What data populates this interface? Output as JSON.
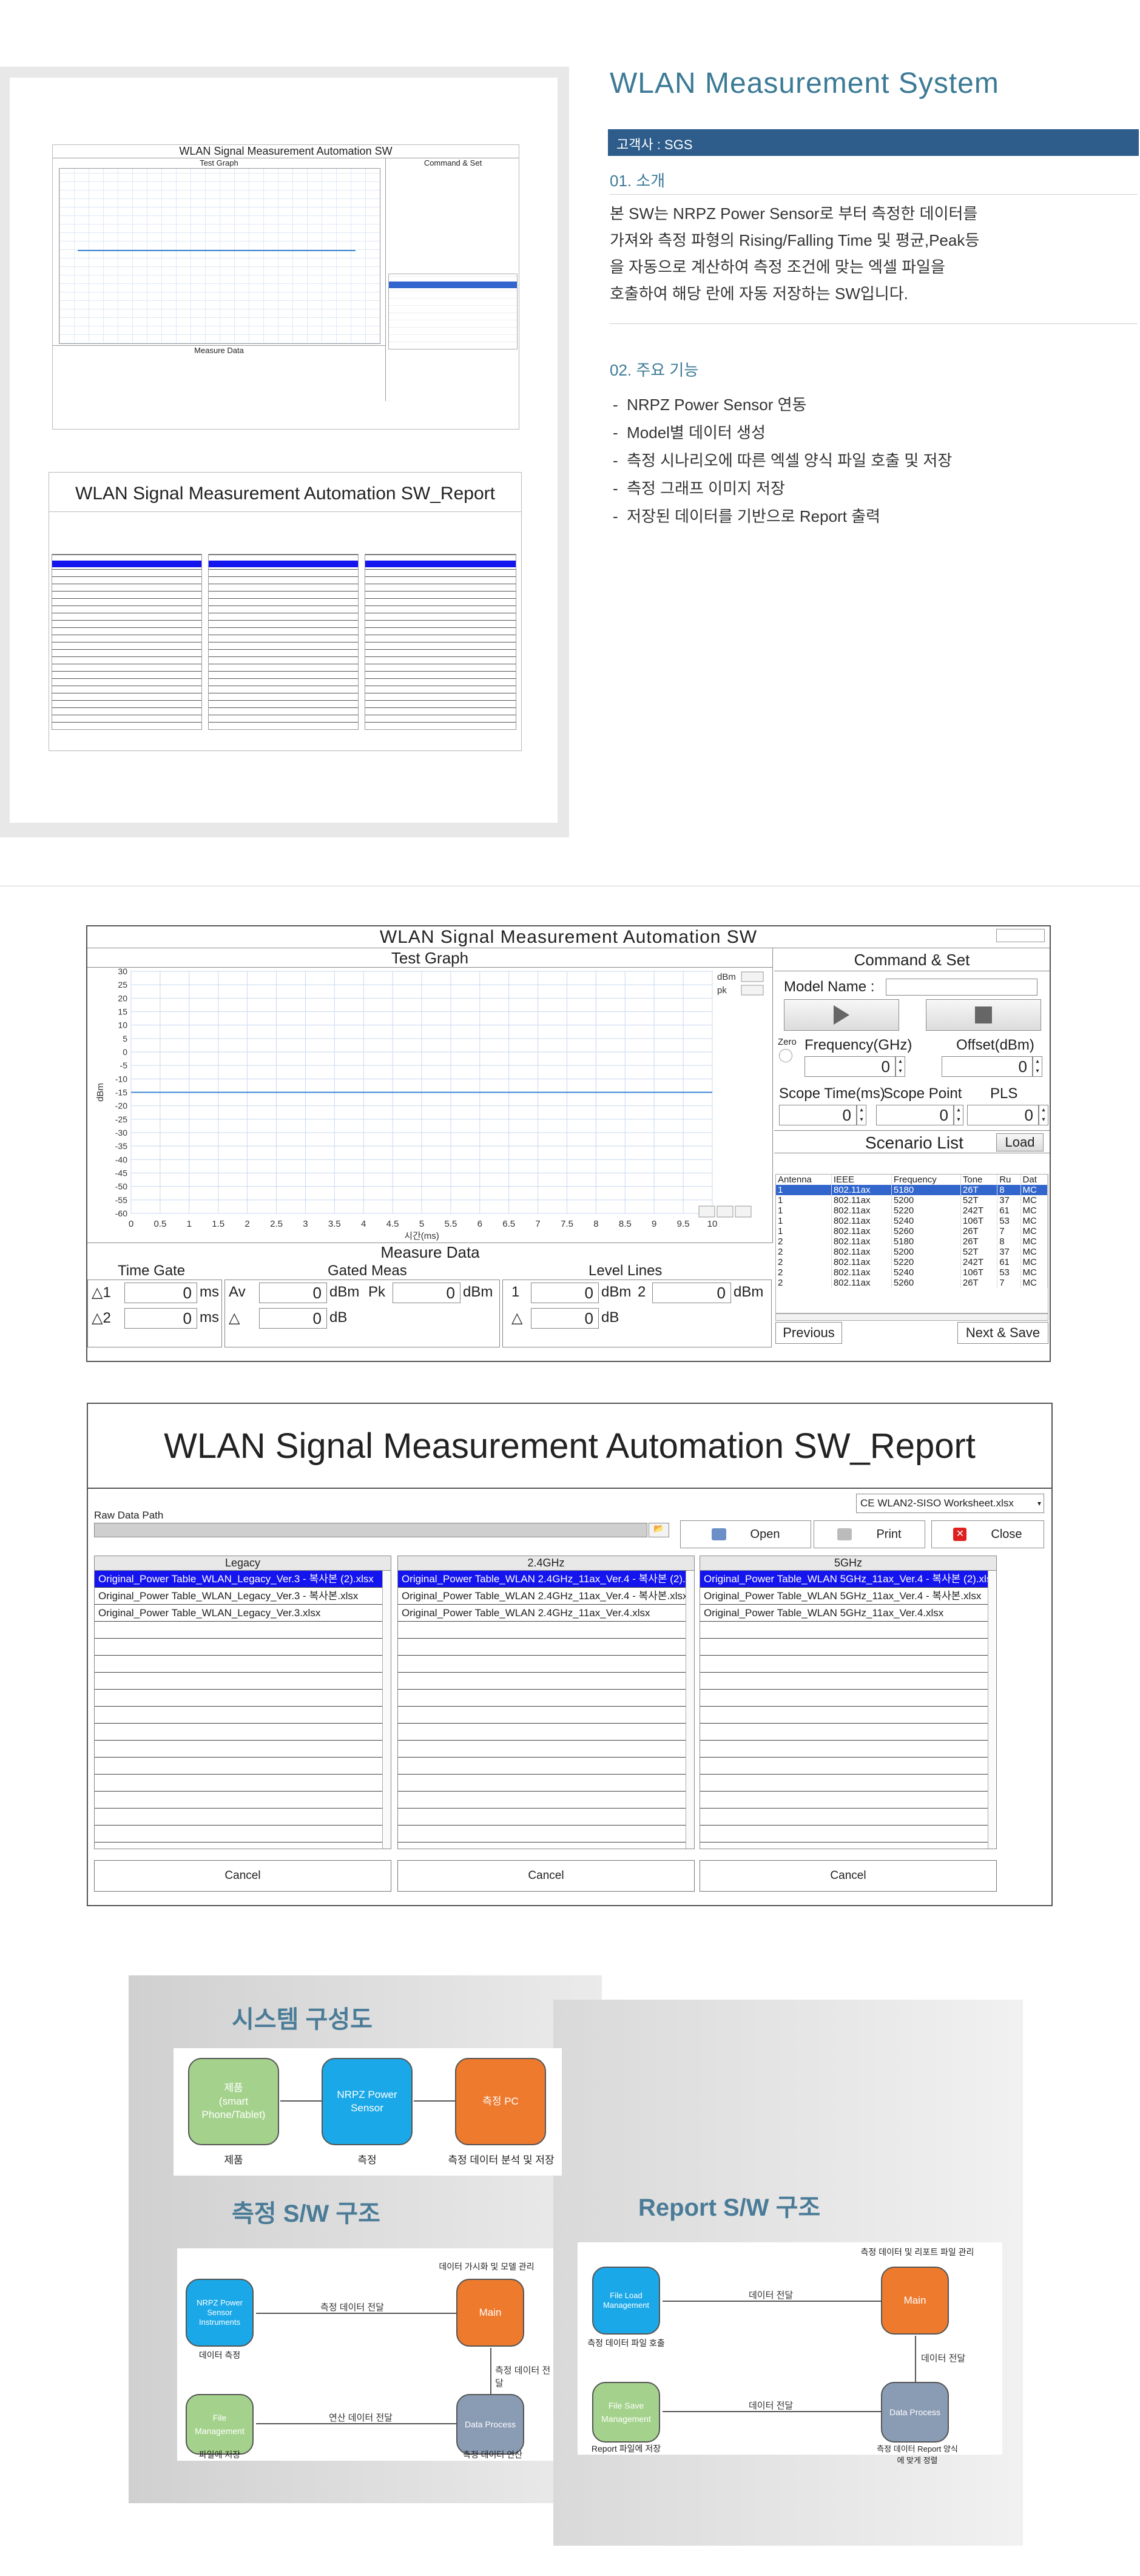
{
  "overview": {
    "title": "WLAN Measurement System",
    "client": "고객사 : SGS",
    "intro_heading": "01. 소개",
    "intro_lines": [
      "본 SW는 NRPZ Power Sensor로 부터 측정한 데이터를",
      "가져와 측정 파형의 Rising/Falling Time 및 평균,Peak등",
      "을 자동으로 계산하여 측정 조건에 맞는 엑셀 파일을",
      "호출하여 해당 란에 자동 저장하는 SW입니다."
    ],
    "features_heading": "02. 주요 기능",
    "features": [
      "NRPZ Power Sensor 연동",
      "Model별 데이터 생성",
      "측정 시나리오에 따른 엑셀 양식 파일 호출 및 저장",
      "측정 그래프 이미지 저장",
      "저장된 데이터를 기반으로 Report 출력"
    ]
  },
  "meas_app": {
    "title": "WLAN  Signal Measurement Automation SW",
    "graph_title": "Test Graph",
    "command_title": "Command & Set",
    "legend": [
      "dBm",
      "pk"
    ],
    "model_name_label": "Model Name :",
    "model_name_value": "",
    "zero_label": "Zero",
    "frequency_label": "Frequency(GHz)",
    "frequency_value": "0",
    "offset_label": "Offset(dBm)",
    "offset_value": "0",
    "scope_time_label": "Scope Time(ms)",
    "scope_time_value": "0",
    "scope_point_label": "Scope Point",
    "scope_point_value": "0",
    "pls_label": "PLS",
    "pls_value": "0",
    "scenario_title": "Scenario List",
    "load_label": "Load",
    "scenario_columns": [
      "Antenna",
      "IEEE",
      "Frequency",
      "Tone",
      "Ru",
      "Dat"
    ],
    "scenario_rows": [
      [
        "1",
        "802.11ax",
        "5180",
        "26T",
        "8",
        "MC"
      ],
      [
        "1",
        "802.11ax",
        "5200",
        "52T",
        "37",
        "MC"
      ],
      [
        "1",
        "802.11ax",
        "5220",
        "242T",
        "61",
        "MC"
      ],
      [
        "1",
        "802.11ax",
        "5240",
        "106T",
        "53",
        "MC"
      ],
      [
        "1",
        "802.11ax",
        "5260",
        "26T",
        "7",
        "MC"
      ],
      [
        "2",
        "802.11ax",
        "5180",
        "26T",
        "8",
        "MC"
      ],
      [
        "2",
        "802.11ax",
        "5200",
        "52T",
        "37",
        "MC"
      ],
      [
        "2",
        "802.11ax",
        "5220",
        "242T",
        "61",
        "MC"
      ],
      [
        "2",
        "802.11ax",
        "5240",
        "106T",
        "53",
        "MC"
      ],
      [
        "2",
        "802.11ax",
        "5260",
        "26T",
        "7",
        "MC"
      ]
    ],
    "previous_label": "Previous",
    "next_label": "Next & Save",
    "measure_title": "Measure Data",
    "time_gate_label": "Time Gate",
    "gated_meas_label": "Gated Meas",
    "level_lines_label": "Level Lines",
    "delta1_label": "△1",
    "delta2_label": "△2",
    "av_label": "Av",
    "pk_label": "Pk",
    "delta_label": "△",
    "level1_label": "1",
    "level2_label": "2",
    "unit_ms": "ms",
    "unit_dbm": "dBm",
    "unit_db": "dB",
    "zero_value": "0",
    "xaxis_label": "시간(ms)",
    "yaxis_label": "dBm"
  },
  "chart_data": {
    "type": "line",
    "title": "Test Graph",
    "xlabel": "시간(ms)",
    "ylabel": "dBm",
    "xlim": [
      0,
      10
    ],
    "ylim": [
      -60,
      30
    ],
    "x_ticks": [
      "0",
      "0.5",
      "1",
      "1.5",
      "2",
      "2.5",
      "3",
      "3.5",
      "4",
      "4.5",
      "5",
      "5.5",
      "6",
      "6.5",
      "7",
      "7.5",
      "8",
      "8.5",
      "9",
      "9.5",
      "10"
    ],
    "y_ticks": [
      "30",
      "25",
      "20",
      "15",
      "10",
      "5",
      "0",
      "-5",
      "-10",
      "-15",
      "-20",
      "-25",
      "-30",
      "-35",
      "-40",
      "-45",
      "-50",
      "-55",
      "-60"
    ],
    "grid": true,
    "series": [
      {
        "name": "dBm",
        "x": [
          0,
          10
        ],
        "values": [
          -15,
          -15
        ],
        "color": "#3b86d4"
      }
    ]
  },
  "report_app": {
    "title": "WLAN Signal Measurement Automation SW_Report",
    "raw_path_label": "Raw Data Path",
    "raw_path_value": "",
    "worksheet_select": "CE WLAN2-SISO Worksheet.xlsx",
    "open_label": "Open",
    "print_label": "Print",
    "close_label": "Close",
    "columns": [
      {
        "head": "Legacy",
        "items": [
          "Original_Power Table_WLAN_Legacy_Ver.3 - 복사본 (2).xlsx",
          "Original_Power Table_WLAN_Legacy_Ver.3 - 복사본.xlsx",
          "Original_Power Table_WLAN_Legacy_Ver.3.xlsx"
        ]
      },
      {
        "head": "2.4GHz",
        "items": [
          "Original_Power Table_WLAN 2.4GHz_11ax_Ver.4 - 복사본 (2).xlsx",
          "Original_Power Table_WLAN 2.4GHz_11ax_Ver.4 - 복사본.xlsx",
          "Original_Power Table_WLAN 2.4GHz_11ax_Ver.4.xlsx"
        ]
      },
      {
        "head": "5GHz",
        "items": [
          "Original_Power Table_WLAN 5GHz_11ax_Ver.4 - 복사본 (2).xlsx",
          "Original_Power Table_WLAN 5GHz_11ax_Ver.4 - 복사본.xlsx",
          "Original_Power Table_WLAN 5GHz_11ax_Ver.4.xlsx"
        ]
      }
    ],
    "cancel_label": "Cancel"
  },
  "diagrams": {
    "system_title": "시스템 구성도",
    "system_nodes": [
      {
        "text": "제품\n(smart\nPhone/Tablet)",
        "caption": "제품"
      },
      {
        "text": "NRPZ Power\nSensor",
        "caption": "측정"
      },
      {
        "text": "측정 PC",
        "caption": "측정 데이터 분석 및 저장"
      }
    ],
    "meas_title": "측정 S/W 구조",
    "meas_nodes": {
      "n1": "NRPZ Power\nSensor\nInstruments",
      "n1_caption": "데이터 측정",
      "n2": "Main",
      "n2_top": "데이터 가시화 및 모델 관리",
      "n3": "Data Process",
      "n3_caption": "측정 데이터 연산",
      "n4": "File\nManagement",
      "n4_caption": "파일에 저장",
      "a1": "측정 데이터 전달",
      "a2": "측정 데이터 전달",
      "a3": "연산 데이터 전달"
    },
    "report_title": "Report S/W 구조",
    "report_nodes": {
      "n1": "File Load\nManagement",
      "n1_caption": "측정 데이터 파일 호출",
      "n2": "Main",
      "n2_top": "측정 데이터 및 리포트 파일 관리",
      "n3": "Data Process",
      "n3_caption": "측정 데이터 Report 양식\n에 맞게 정렬",
      "n4": "File Save\nManagement",
      "n4_caption": "Report 파일에 저장",
      "a1": "데이터 전달",
      "a2": "데이터 전달",
      "a3": "데이터 전달"
    }
  }
}
